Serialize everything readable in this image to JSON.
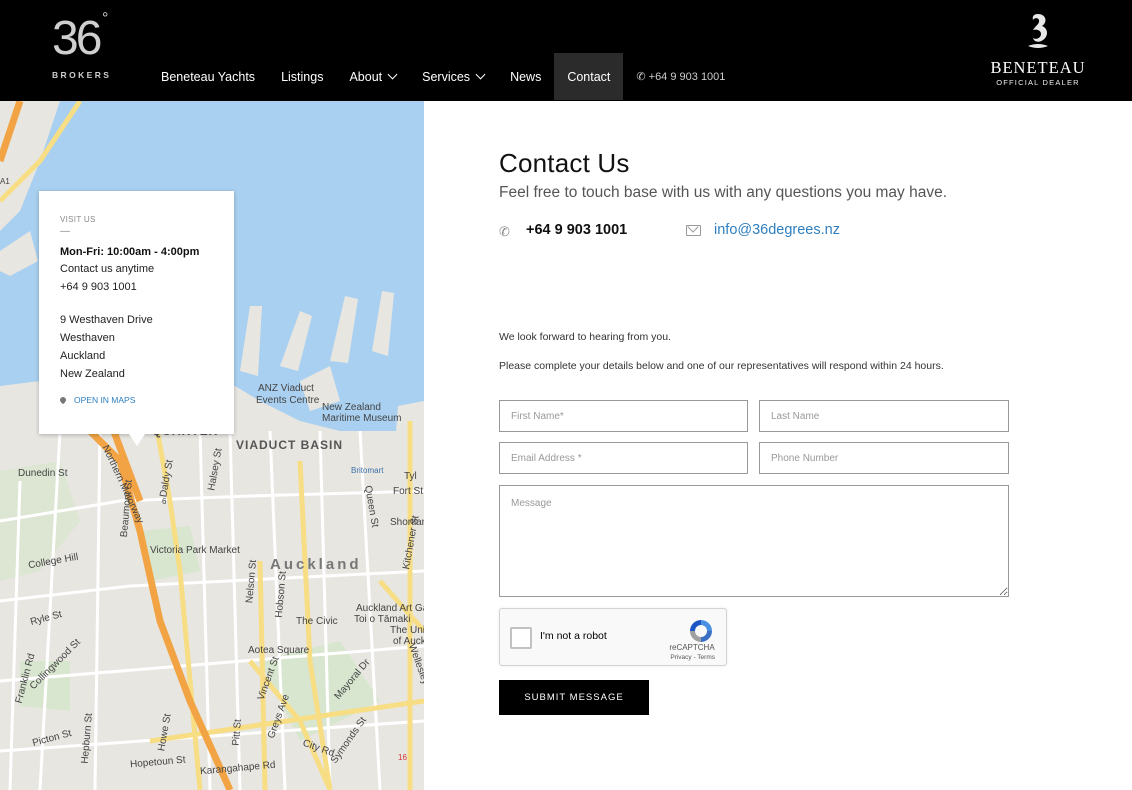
{
  "header": {
    "logo": {
      "number": "36",
      "degree": "°",
      "word": "BROKERS"
    },
    "nav": [
      {
        "label": "Beneteau Yachts",
        "has_dropdown": false,
        "active": false
      },
      {
        "label": "Listings",
        "has_dropdown": false,
        "active": false
      },
      {
        "label": "About",
        "has_dropdown": true,
        "active": false
      },
      {
        "label": "Services",
        "has_dropdown": true,
        "active": false
      },
      {
        "label": "News",
        "has_dropdown": false,
        "active": false
      },
      {
        "label": "Contact",
        "has_dropdown": false,
        "active": true
      }
    ],
    "phone": "+64 9 903 1001",
    "partner": {
      "name": "BENETEAU",
      "subtitle": "OFFICIAL DEALER"
    }
  },
  "map": {
    "labels": {
      "viaduct_basin": "VIADUCT BASIN",
      "quarter": "QUARTER",
      "auckland": "Auckland",
      "anz": "ANZ Viaduct",
      "events_centre": "Events Centre",
      "nz": "New Zealand",
      "maritime": "Maritime Museum",
      "britomart": "Britomart",
      "victoria_park": "Victoria Park Market",
      "civic": "The Civic",
      "aotea": "Aotea Square",
      "art_gallery": "Auckland Art Ga",
      "toi": "Toi o Tāmaki",
      "the_univ": "The Univ",
      "of_auckland": "of Auckl",
      "dunedin": "Dunedin St",
      "northern_mwy": "Northern Motorway",
      "college_hill": "College Hill",
      "karangahape": "Karangahape Rd",
      "symonds": "Symonds St",
      "mayoral": "Mayoral Dr",
      "queen": "Queen St",
      "hobson": "Hobson St",
      "nelson": "Nelson St",
      "high": "High St",
      "albert": "Albert St",
      "kitchener": "Kitchener St",
      "wellesley": "Wellesley St E",
      "city_rd": "City Rd",
      "pitt": "Pitt St",
      "vincent": "Vincent St",
      "greys": "Greys Ave",
      "hopetoun": "Hopetoun St",
      "howe": "Howe St",
      "hepburn": "Hepburn St",
      "franklin": "Franklin Rd",
      "collingwood": "Collingwood St",
      "picton": "Picton St",
      "ryle": "Ryle St",
      "beaumont": "Beaumont St",
      "halsey": "Halsey St",
      "daldy": "Daldy St",
      "fort": "Fort St",
      "shortland": "Shortland St",
      "lower_hobson": "Hobson St",
      "tyler": "Tyl",
      "a1": "A1",
      "sixes": "6",
      "sixteen": "16"
    }
  },
  "visit_card": {
    "heading": "VISIT US",
    "dash": "—",
    "hours": "Mon-Fri: 10:00am - 4:00pm",
    "anytime": "Contact us anytime",
    "phone": "+64 9 903 1001",
    "address": [
      "9 Westhaven Drive",
      "Westhaven",
      "Auckland",
      "New Zealand"
    ],
    "open_maps": "OPEN IN MAPS"
  },
  "contact": {
    "title": "Contact Us",
    "subtitle": "Feel free to touch base with us with any questions you may have.",
    "phone": "+64 9 903 1001",
    "email": "info@36degrees.nz",
    "intro": "We look forward to hearing from you.",
    "instructions": "Please complete your details below and one of our representatives will respond within 24 hours."
  },
  "form": {
    "first_name_placeholder": "First Name*",
    "last_name_placeholder": "Last Name",
    "email_placeholder": "Email Address *",
    "phone_placeholder": "Phone Number",
    "message_placeholder": "Message",
    "recaptcha_label": "I'm not a robot",
    "recaptcha_brand": "reCAPTCHA",
    "recaptcha_terms": "Privacy - Terms",
    "submit_label": "SUBMIT MESSAGE"
  },
  "colors": {
    "header_bg": "#000000",
    "nav_active_bg": "#2b2b2b",
    "link_blue": "#2e7fc0",
    "water": "#a9d0f0",
    "land": "#e8e6e1",
    "motorway": "#f2a444"
  }
}
